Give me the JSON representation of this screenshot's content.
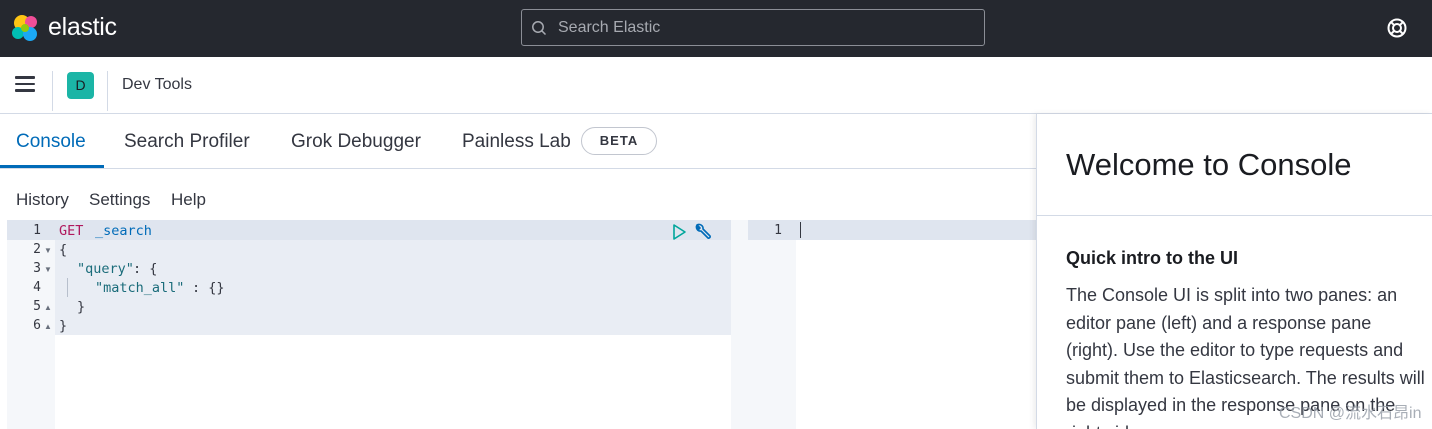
{
  "header": {
    "brand": "elastic",
    "search_placeholder": "Search Elastic"
  },
  "subbar": {
    "space_initial": "D",
    "breadcrumb": "Dev Tools"
  },
  "tabs": [
    {
      "label": "Console",
      "active": true
    },
    {
      "label": "Search Profiler",
      "active": false
    },
    {
      "label": "Grok Debugger",
      "active": false
    },
    {
      "label": "Painless Lab",
      "active": false
    }
  ],
  "beta_badge": "BETA",
  "console_menu": [
    "History",
    "Settings",
    "Help"
  ],
  "editor": {
    "line_numbers": [
      "1",
      "2",
      "3",
      "4",
      "5",
      "6"
    ],
    "lines": {
      "method": "GET",
      "path": "_search",
      "l2": "{",
      "l3_key": "\"query\"",
      "l3_rest": ": {",
      "l4_key": "\"match_all\"",
      "l4_rest": ": {}",
      "l5": "}",
      "l6": "}"
    }
  },
  "response": {
    "line_numbers": [
      "1"
    ]
  },
  "flyout": {
    "title": "Welcome to Console",
    "subtitle": "Quick intro to the UI",
    "body": "The Console UI is split into two panes: an editor pane (left) and a response pane (right). Use the editor to type requests and submit them to Elasticsearch. The results will be displayed in the response pane on the right side."
  },
  "watermark": "CSDN @流水石昂in",
  "colors": {
    "header_bg": "#25282f",
    "accent": "#006bb8",
    "space_avatar": "#1bb5a6",
    "keyword": "#b0185d"
  },
  "icons": [
    "elastic-logo",
    "search-icon",
    "help-icon",
    "menu-icon",
    "play-icon",
    "wrench-icon"
  ]
}
